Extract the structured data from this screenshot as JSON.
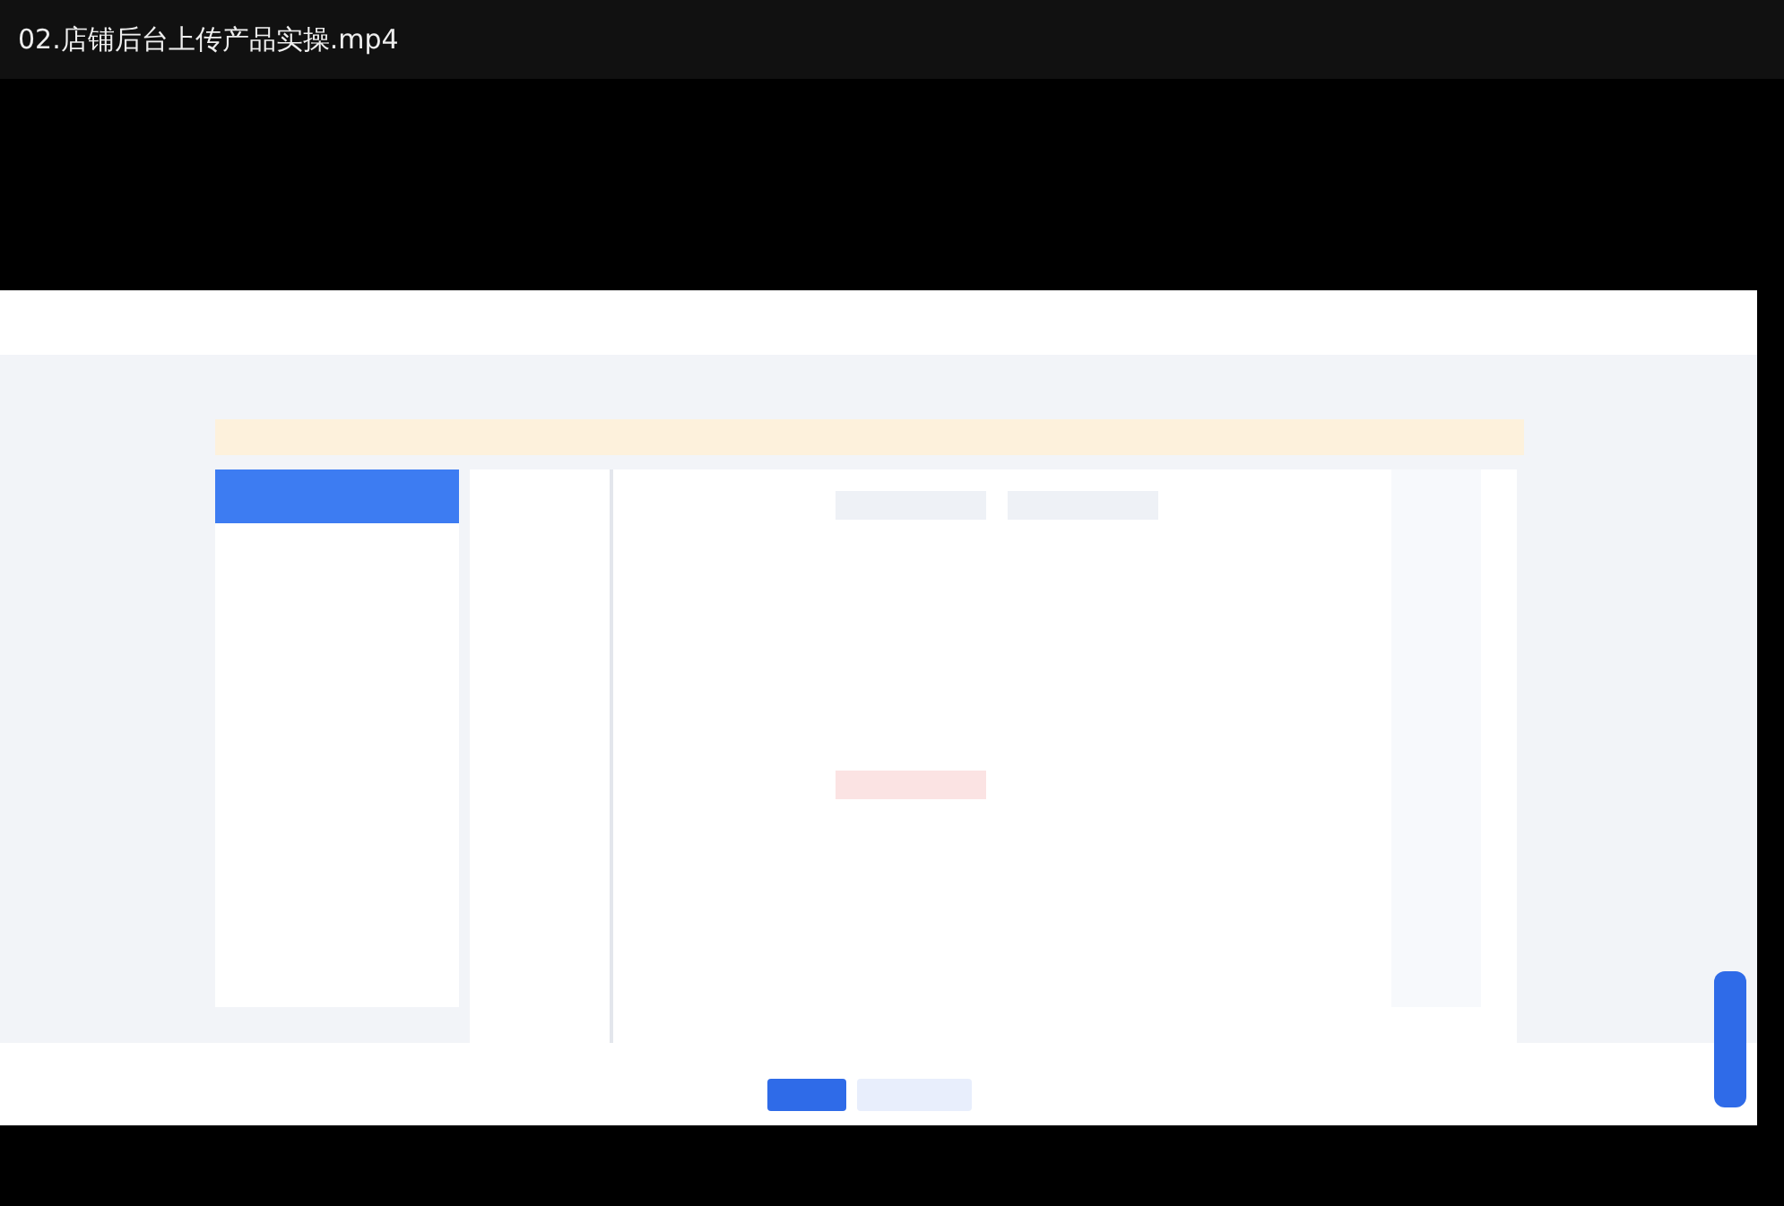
{
  "window": {
    "title": "02.店铺后台上传产品实操.mp4"
  }
}
